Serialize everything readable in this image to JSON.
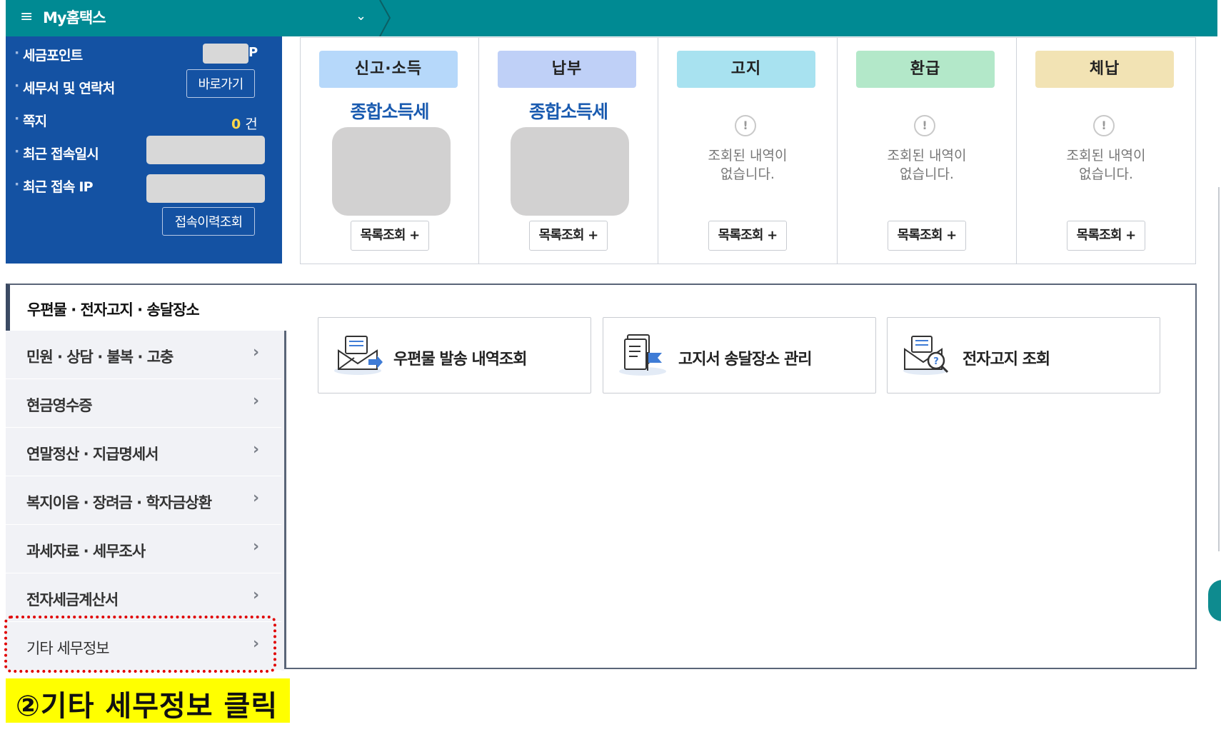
{
  "topbar": {
    "menu_icon": "hamburger-icon",
    "brand": "My홈택스",
    "chevron": "chevron-down-icon"
  },
  "info": {
    "tax_point_label": "세금포인트",
    "tax_point_unit": "P",
    "tax_office_label": "세무서 및 연락처",
    "shortcut_button": "바로가기",
    "message_label": "쪽지",
    "message_count": "0",
    "message_unit": "건",
    "last_login_label": "최근 접속일시",
    "last_ip_label": "최근 접속 IP",
    "history_button": "접속이력조회"
  },
  "status": [
    {
      "tag": "신고·소득",
      "color": "#b6d8fa",
      "sub": "종합소득세",
      "button": "목록조회 +"
    },
    {
      "tag": "납부",
      "color": "#bfd0f7",
      "sub": "종합소득세",
      "button": "목록조회 +"
    },
    {
      "tag": "고지",
      "color": "#a8e2f0",
      "empty": "조회된 내역이 없습니다.",
      "button": "목록조회 +"
    },
    {
      "tag": "환급",
      "color": "#b3e8c9",
      "empty": "조회된 내역이 없습니다.",
      "button": "목록조회 +"
    },
    {
      "tag": "체납",
      "color": "#f2e3b4",
      "empty": "조회된 내역이 없습니다.",
      "button": "목록조회 +"
    }
  ],
  "menu": {
    "active": "우편물 · 전자고지 · 송달장소",
    "items": [
      "민원 · 상담 · 불복 · 고충",
      "현금영수증",
      "연말정산 · 지급명세서",
      "복지이음 · 장려금 · 학자금상환",
      "과세자료 · 세무조사",
      "전자세금계산서",
      "기타 세무정보"
    ]
  },
  "services": [
    {
      "label": "우편물 발송 내역조회",
      "icon": "mail-send-icon"
    },
    {
      "label": "고지서 송달장소 관리",
      "icon": "document-flag-icon"
    },
    {
      "label": "전자고지 조회",
      "icon": "mail-search-icon"
    }
  ],
  "callout": "②기타 세무정보 클릭"
}
